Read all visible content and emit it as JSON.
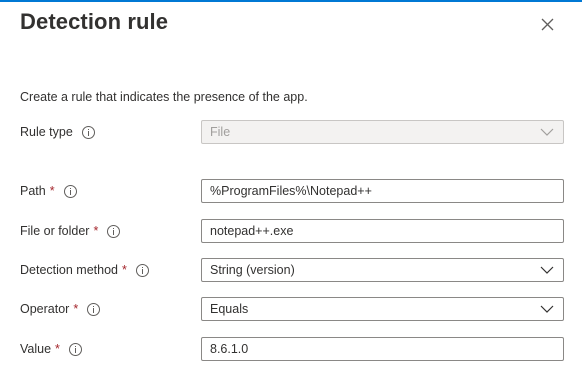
{
  "panel": {
    "title": "Detection rule",
    "description": "Create a rule that indicates the presence of the app."
  },
  "form": {
    "rule_type": {
      "label": "Rule type",
      "value": "File",
      "disabled": true
    },
    "path": {
      "label": "Path",
      "required_mark": "*",
      "value": "%ProgramFiles%\\Notepad++"
    },
    "file_or_folder": {
      "label": "File or folder",
      "required_mark": "*",
      "value": "notepad++.exe"
    },
    "detection_method": {
      "label": "Detection method",
      "required_mark": "*",
      "value": "String (version)"
    },
    "operator": {
      "label": "Operator",
      "required_mark": "*",
      "value": "Equals"
    },
    "value": {
      "label": "Value",
      "required_mark": "*",
      "value": "8.6.1.0"
    }
  },
  "colors": {
    "accent": "#0078d4",
    "required": "#a4262c",
    "text": "#323130",
    "border": "#8a8886",
    "disabled_bg": "#f3f2f1"
  },
  "icons": {
    "close": "close-icon",
    "info": "info-icon",
    "dropdown": "chevron-down-icon"
  }
}
